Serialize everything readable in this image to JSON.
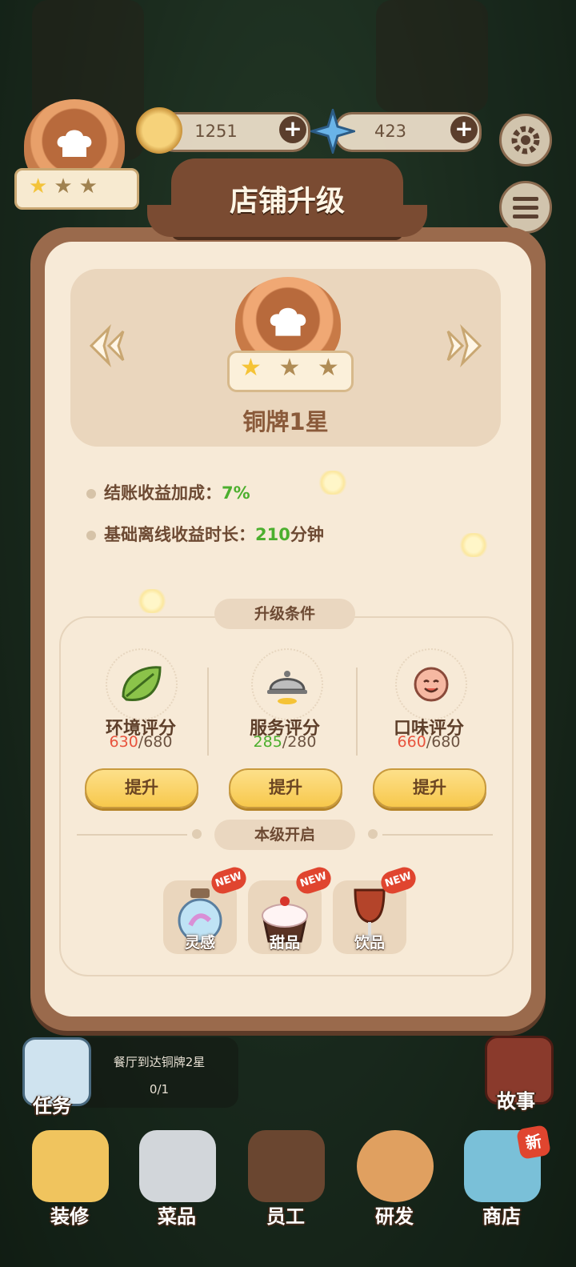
{
  "hud": {
    "coins": "1251",
    "gems": "423",
    "plus": "+"
  },
  "dialog": {
    "title": "店铺升级",
    "rank_name": "铜牌1星",
    "stars_filled": 1,
    "stars_total": 3,
    "stats": [
      {
        "label": "结账收益加成：",
        "value": "7%",
        "suffix": ""
      },
      {
        "label": "基础离线收益时长：",
        "value": "210",
        "suffix": "分钟"
      }
    ],
    "conditions_title": "升级条件",
    "conditions": [
      {
        "label": "环境评分",
        "current": "630",
        "target": "/680",
        "current_color": "#e8543e",
        "icon": "leaf-icon",
        "button": "提升"
      },
      {
        "label": "服务评分",
        "current": "285",
        "target": "/280",
        "current_color": "#4caf2e",
        "icon": "cloche-icon",
        "button": "提升"
      },
      {
        "label": "口味评分",
        "current": "660",
        "target": "/680",
        "current_color": "#e8543e",
        "icon": "smile-face-icon",
        "button": "提升"
      }
    ],
    "unlock_title": "本级开启",
    "unlocks": [
      {
        "label": "灵感",
        "tag": "NEW",
        "icon": "inspiration-bottle-icon"
      },
      {
        "label": "甜品",
        "tag": "NEW",
        "icon": "cupcake-icon"
      },
      {
        "label": "饮品",
        "tag": "NEW",
        "icon": "wine-glass-icon"
      }
    ]
  },
  "task": {
    "title": "餐厅到达铜牌2星",
    "progress": "0/1",
    "label": "任务"
  },
  "side": {
    "story": "故事"
  },
  "nav": [
    {
      "label": "装修",
      "icon": "decorate-icon"
    },
    {
      "label": "菜品",
      "icon": "dishes-icon"
    },
    {
      "label": "员工",
      "icon": "staff-icon"
    },
    {
      "label": "研发",
      "icon": "research-pot-icon"
    },
    {
      "label": "商店",
      "icon": "shop-icon",
      "badge": "新"
    }
  ],
  "colors": {
    "accent": "#f7c84c",
    "panel": "#9a6a4c",
    "good": "#4caf2e",
    "bad": "#e8543e"
  }
}
